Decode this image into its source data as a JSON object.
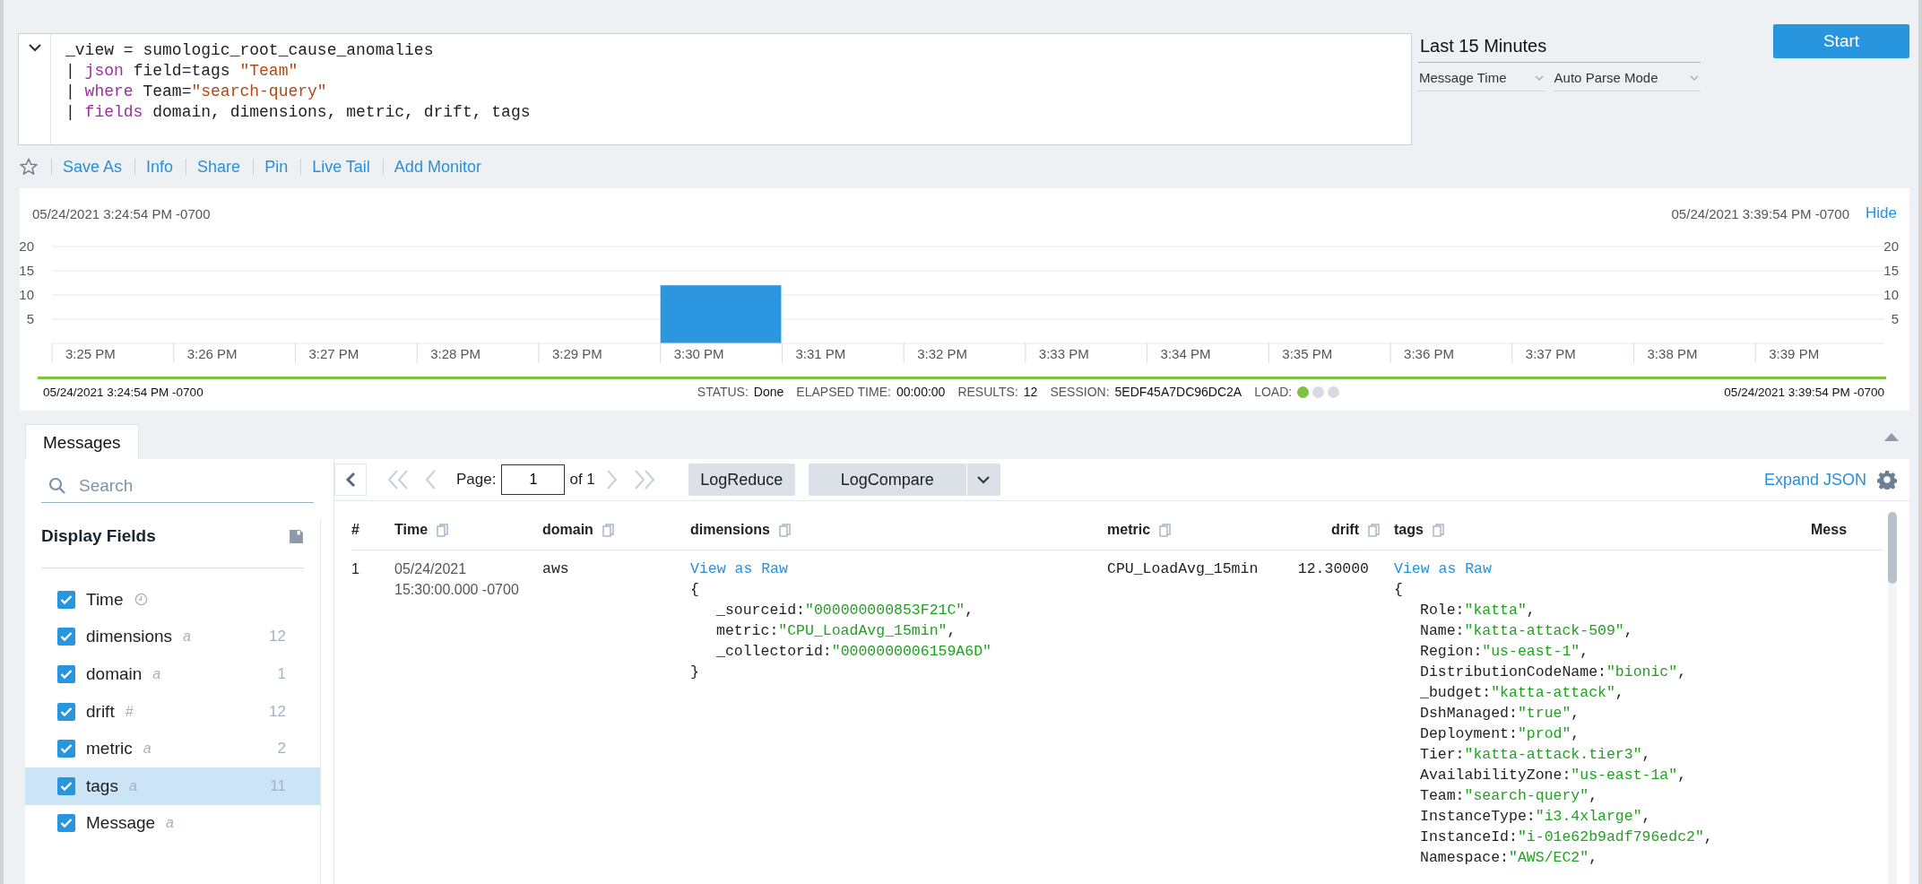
{
  "query": {
    "lines": [
      {
        "tokens": [
          {
            "text": "_view = sumologic_root_cause_anomalies",
            "kind": "plain"
          }
        ]
      },
      {
        "tokens": [
          {
            "text": "| ",
            "kind": "plain"
          },
          {
            "text": "json",
            "kind": "keyword"
          },
          {
            "text": " field=tags ",
            "kind": "plain"
          },
          {
            "text": "\"Team\"",
            "kind": "string"
          }
        ]
      },
      {
        "tokens": [
          {
            "text": "| ",
            "kind": "plain"
          },
          {
            "text": "where",
            "kind": "keyword"
          },
          {
            "text": " Team=",
            "kind": "plain"
          },
          {
            "text": "\"search-query\"",
            "kind": "string"
          }
        ]
      },
      {
        "tokens": [
          {
            "text": "| ",
            "kind": "plain"
          },
          {
            "text": "fields",
            "kind": "keyword"
          },
          {
            "text": " domain, dimensions, metric, drift, tags",
            "kind": "plain"
          }
        ]
      }
    ]
  },
  "time_range": {
    "label": "Last 15 Minutes",
    "dropdowns": [
      "Message Time",
      "Auto Parse Mode"
    ]
  },
  "start_button": "Start",
  "actions": [
    "Save As",
    "Info",
    "Share",
    "Pin",
    "Live Tail",
    "Add Monitor"
  ],
  "histogram": {
    "start_time": "05/24/2021 3:24:54 PM -0700",
    "end_time": "05/24/2021 3:39:54 PM -0700",
    "hide_link": "Hide",
    "chart_data": {
      "type": "bar",
      "categories": [
        "3:25 PM",
        "3:26 PM",
        "3:27 PM",
        "3:28 PM",
        "3:29 PM",
        "3:30 PM",
        "3:31 PM",
        "3:32 PM",
        "3:33 PM",
        "3:34 PM",
        "3:35 PM",
        "3:36 PM",
        "3:37 PM",
        "3:38 PM",
        "3:39 PM"
      ],
      "values": [
        0,
        0,
        0,
        0,
        0,
        12,
        0,
        0,
        0,
        0,
        0,
        0,
        0,
        0,
        0
      ],
      "ylim": [
        0,
        20
      ],
      "yticks": [
        5,
        10,
        15,
        20
      ],
      "grid": true
    },
    "right_axis_labels": [
      "20",
      "15",
      "10",
      "5"
    ],
    "range_start": "05/24/2021 3:24:54 PM -0700",
    "range_end": "05/24/2021 3:39:54 PM -0700",
    "status": [
      {
        "label": "STATUS:",
        "value": "Done"
      },
      {
        "label": "ELAPSED TIME:",
        "value": "00:00:00"
      },
      {
        "label": "RESULTS:",
        "value": "12"
      },
      {
        "label": "SESSION:",
        "value": "5EDF45A7DC96DC2A"
      }
    ],
    "load_label": "LOAD:",
    "load": [
      {
        "color": "#7dc242"
      },
      {
        "color": "#d5dbe1"
      },
      {
        "color": "#d5dbe1"
      }
    ]
  },
  "tabs": [
    {
      "label": "Messages",
      "selected": true
    }
  ],
  "sidebar": {
    "search_placeholder": "Search",
    "title": "Display Fields",
    "fields": [
      {
        "label": "Time",
        "kind": "time",
        "checked": true,
        "selected": false
      },
      {
        "label": "dimensions",
        "kind": "typed",
        "type": "a",
        "count": "12",
        "checked": true,
        "selected": false
      },
      {
        "label": "domain",
        "kind": "typed",
        "type": "a",
        "count": "1",
        "checked": true,
        "selected": false
      },
      {
        "label": "drift",
        "kind": "typed",
        "type": "#",
        "count": "12",
        "checked": true,
        "selected": false
      },
      {
        "label": "metric",
        "kind": "typed",
        "type": "a",
        "count": "2",
        "checked": true,
        "selected": false
      },
      {
        "label": "tags",
        "kind": "typed",
        "type": "a",
        "count": "11",
        "checked": true,
        "selected": true
      },
      {
        "label": "Message",
        "kind": "typed",
        "type": "a",
        "checked": true,
        "selected": false
      }
    ]
  },
  "pager": {
    "page_label": "Page:",
    "page_value": "1",
    "of_label": "of 1",
    "nav": [
      {
        "kind": "first",
        "disabled": true
      },
      {
        "kind": "prev",
        "disabled": true
      },
      {
        "kind": "next",
        "disabled": true
      },
      {
        "kind": "last",
        "disabled": true
      }
    ]
  },
  "log_reduce": "LogReduce",
  "log_compare": "LogCompare",
  "expand_link": "Expand JSON",
  "table": {
    "columns": [
      {
        "label": "#",
        "copy_icon": false,
        "numeric": false
      },
      {
        "label": "Time",
        "copy_icon": true,
        "numeric": false
      },
      {
        "label": "domain",
        "copy_icon": true,
        "numeric": false
      },
      {
        "label": "dimensions",
        "copy_icon": true,
        "numeric": false
      },
      {
        "label": "metric",
        "copy_icon": true,
        "numeric": false
      },
      {
        "label": "drift",
        "copy_icon": true,
        "numeric": true
      },
      {
        "label": "tags",
        "copy_icon": true,
        "numeric": false
      },
      {
        "label": "Mess",
        "copy_icon": false,
        "numeric": false
      }
    ],
    "rows": [
      {
        "number": "1",
        "time": [
          "05/24/2021",
          "15:30:00.000 -0700"
        ],
        "domain": "aws",
        "dimensions": {
          "link": "View as Raw",
          "open": "{",
          "close": "}",
          "entries": [
            {
              "key": "_sourceid:",
              "value": "\"000000000853F21C\"",
              "end": ","
            },
            {
              "key": "metric:",
              "value": "\"CPU_LoadAvg_15min\"",
              "end": ","
            },
            {
              "key": "_collectorid:",
              "value": "\"0000000006159A6D\""
            }
          ]
        },
        "metric": "CPU_LoadAvg_15min",
        "drift": "12.30000",
        "tags": {
          "link": "View as Raw",
          "open": "{",
          "entries": [
            {
              "key": "Role:",
              "value": "\"katta\"",
              "end": ","
            },
            {
              "key": "Name:",
              "value": "\"katta-attack-509\"",
              "end": ","
            },
            {
              "key": "Region:",
              "value": "\"us-east-1\"",
              "end": ","
            },
            {
              "key": "DistributionCodeName:",
              "value": "\"bionic\"",
              "end": ","
            },
            {
              "key": "_budget:",
              "value": "\"katta-attack\"",
              "end": ","
            },
            {
              "key": "DshManaged:",
              "value": "\"true\"",
              "end": ","
            },
            {
              "key": "Deployment:",
              "value": "\"prod\"",
              "end": ","
            },
            {
              "key": "Tier:",
              "value": "\"katta-attack.tier3\"",
              "end": ","
            },
            {
              "key": "AvailabilityZone:",
              "value": "\"us-east-1a\"",
              "end": ","
            },
            {
              "key": "Team:",
              "value": "\"search-query\"",
              "end": ","
            },
            {
              "key": "InstanceType:",
              "value": "\"i3.4xlarge\"",
              "end": ","
            },
            {
              "key": "InstanceId:",
              "value": "\"i-01e62b9adf796edc2\"",
              "end": ","
            },
            {
              "key": "Namespace:",
              "value": "\"AWS/EC2\"",
              "end": ","
            }
          ]
        }
      }
    ]
  }
}
